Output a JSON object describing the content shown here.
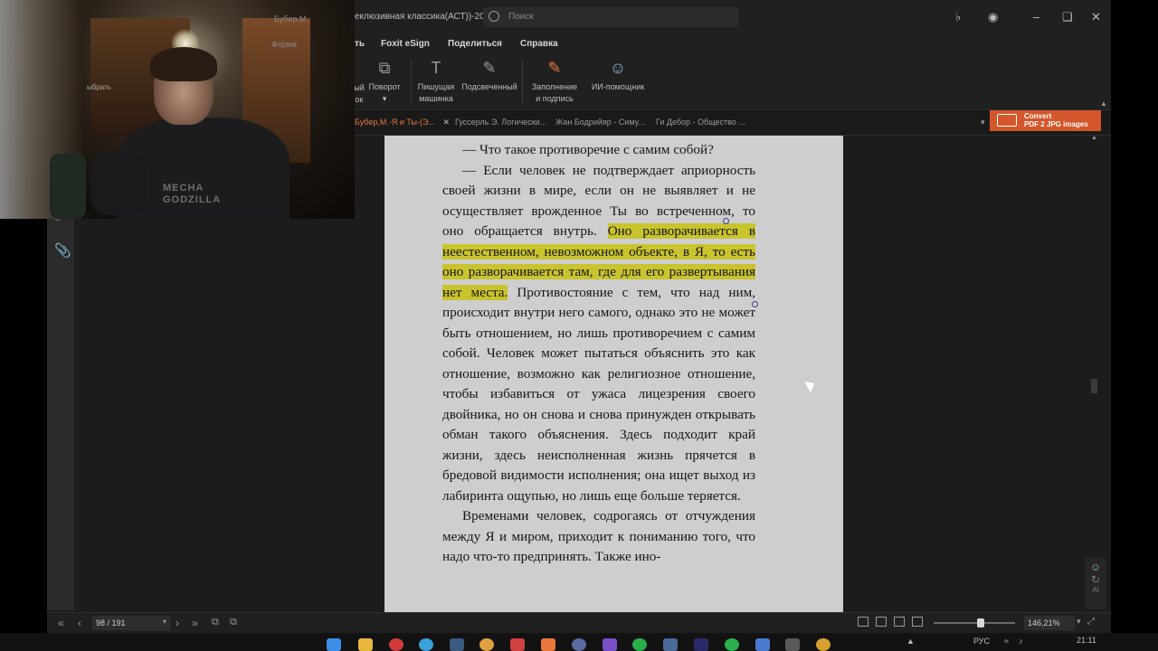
{
  "window": {
    "title": "еклюзивная классика(АСТ))-20...",
    "search_placeholder": "Поиск"
  },
  "menu": {
    "items": [
      "ть",
      "Foxit eSign",
      "Поделиться",
      "Справка"
    ]
  },
  "ribbon": {
    "partial_label_1": "ый",
    "partial_label_2": "ок",
    "rotate": "Поворот",
    "typewriter_line1": "Пишущая",
    "typewriter_line2": "машинка",
    "highlight": "Подсвеченный",
    "fill_sign_line1": "Заполнение",
    "fill_sign_line2": "и подпись",
    "ai_assistant": "ИИ-помощник"
  },
  "tabs": [
    "Бубер,М.-Я и Ты-(Э...",
    "Гуссерль Э. Логически...",
    "Жан Бодрийяр - Симу...",
    "Ги Дебор - Общество ..."
  ],
  "convert_banner": {
    "line1": "Convert",
    "line2": "PDF 2 JPG images"
  },
  "webcam_overlay": {
    "shirt_line1": "MECHA",
    "shirt_line2": "GODZILLA",
    "background_text_1": "Бубер,М.",
    "background_text_2": "Форма",
    "background_text_3": "ыбрать",
    "background_text_4": "Яо"
  },
  "document": {
    "paragraphs": [
      {
        "segments": [
          {
            "text": "— Что такое противоречие с самим собой?",
            "highlight": false
          }
        ]
      },
      {
        "segments": [
          {
            "text": "— Если человек не подтверждает априорность своей жизни в мире, если он не выявляет и не осуществляет врожденное Ты во встреченном, то оно обращается внутрь. ",
            "highlight": false
          },
          {
            "text": "Оно разворачивается в неестественном, невозможном объекте, в Я, то есть оно разворачивается там, где для его развертывания нет места.",
            "highlight": true
          },
          {
            "text": " Противостояние с тем, что над ним, происходит внутри него самого, однако это не может быть отношением, но лишь противоречием с самим собой. Человек может пытаться объяснить это как отношение, возможно как религиозное отношение, чтобы избавиться от ужаса лицезрения своего двойника, но он снова и снова принужден открывать обман такого объяснения. Здесь подходит край жизни, здесь неисполненная жизнь прячется в бредовой видимости исполнения; она ищет выход из лабиринта ощупью, но лишь еще больше теряется.",
            "highlight": false
          }
        ]
      },
      {
        "segments": [
          {
            "text": "Временами человек, содрогаясь от отчуждения между Я и миром, приходит к пониманию того, что надо что-то предпринять. Также ино-",
            "highlight": false
          }
        ]
      }
    ]
  },
  "status": {
    "page": "98 / 191",
    "zoom": "146,21%"
  },
  "tray": {
    "language": "РУС",
    "time": "21:11"
  },
  "colors": {
    "accent": "#e8773c",
    "highlight": "#c9c42d",
    "page": "#cecece"
  }
}
